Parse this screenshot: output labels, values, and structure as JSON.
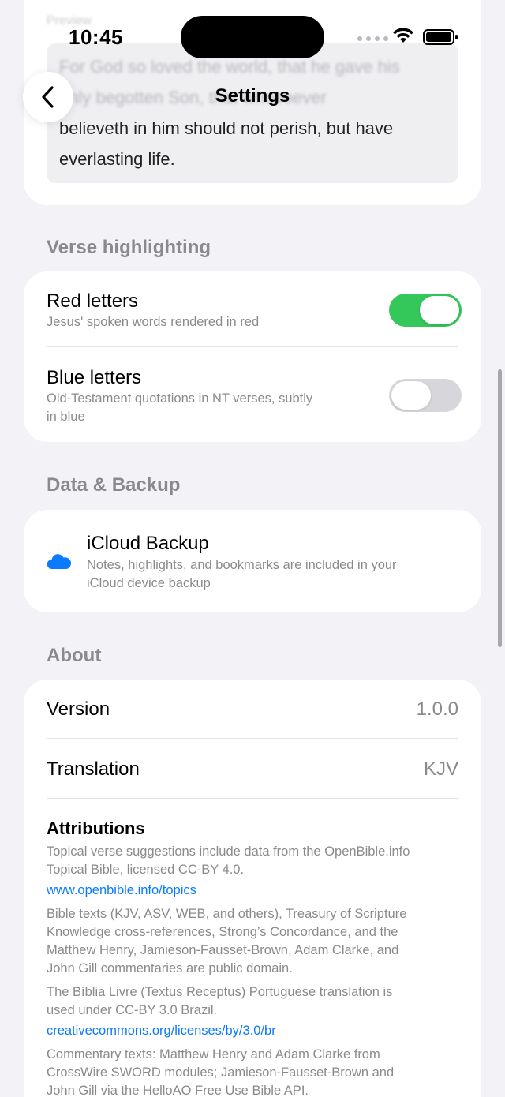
{
  "status": {
    "time": "10:45"
  },
  "nav": {
    "title": "Settings"
  },
  "preview": {
    "label": "Preview",
    "line1": "For God so loved the world, that he gave his",
    "line2": "only begotten Son, that whosoever",
    "line3": "believeth in him should not perish, but have",
    "line4": "everlasting life."
  },
  "verse_highlighting": {
    "header": "Verse highlighting",
    "red": {
      "title": "Red letters",
      "subtitle": "Jesus' spoken words rendered in red",
      "enabled": true
    },
    "blue": {
      "title": "Blue letters",
      "subtitle_line1": "Old-Testament quotations in NT verses, subtly",
      "subtitle_line2": "in blue",
      "enabled": false
    }
  },
  "data_backup": {
    "header": "Data & Backup",
    "icon": "cloud-icon",
    "title": "iCloud Backup",
    "subtitle_line1": "Notes, highlights, and bookmarks are included in your",
    "subtitle_line2": "iCloud device backup"
  },
  "about": {
    "header": "About",
    "version_label": "Version",
    "version_value": "1.0.0",
    "translation_label": "Translation",
    "translation_value": "KJV",
    "attributions_title": "Attributions",
    "attr1_line1": "Topical verse suggestions include data from the OpenBible.info",
    "attr1_line2": "Topical Bible, licensed CC-BY 4.0.",
    "link1": "www.openbible.info/topics",
    "attr2_line1": "Bible texts (KJV, ASV, WEB, and others), Treasury of Scripture",
    "attr2_line2": "Knowledge cross-references, Strong’s Concordance, and the",
    "attr2_line3": "Matthew Henry, Jamieson-Fausset-Brown, Adam Clarke, and",
    "attr2_line4": "John Gill commentaries are public domain.",
    "attr3_line1": "The Bíblia Livre (Textus Receptus) Portuguese translation is",
    "attr3_line2": "used under CC-BY 3.0 Brazil.",
    "link2": "creativecommons.org/licenses/by/3.0/br",
    "attr4_line1": "Commentary texts: Matthew Henry and Adam Clarke from",
    "attr4_line2": "CrossWire SWORD modules; Jamieson-Fausset-Brown and",
    "attr4_line3": "John Gill via the HelloAO Free Use Bible API."
  },
  "colors": {
    "accent": "#0a7aff",
    "toggle_on": "#34c759",
    "background": "#f2f2f7"
  }
}
